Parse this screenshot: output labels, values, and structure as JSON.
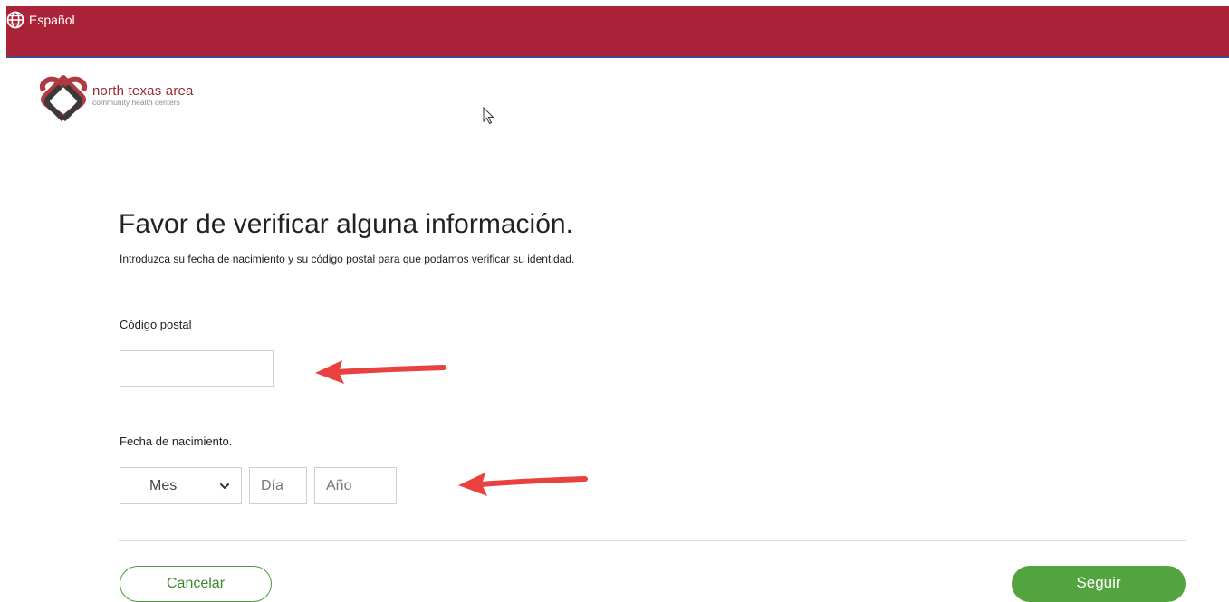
{
  "header": {
    "language_label": "Español",
    "bar_color": "#ab2338"
  },
  "logo": {
    "name": "north texas area",
    "tagline": "community health centers"
  },
  "form": {
    "title": "Favor de verificar alguna información.",
    "subtitle": "Introduzca su fecha de nacimiento y su código postal para que podamos verificar su identidad.",
    "zip": {
      "label": "Código postal",
      "value": "",
      "placeholder": ""
    },
    "dob": {
      "label": "Fecha de nacimiento.",
      "month_selected": "Mes",
      "day_placeholder": "Día",
      "year_placeholder": "Año"
    }
  },
  "actions": {
    "cancel_label": "Cancelar",
    "next_label": "Seguir",
    "accent_color": "#53a441"
  },
  "annotations": {
    "arrow_color": "#e8413f"
  }
}
